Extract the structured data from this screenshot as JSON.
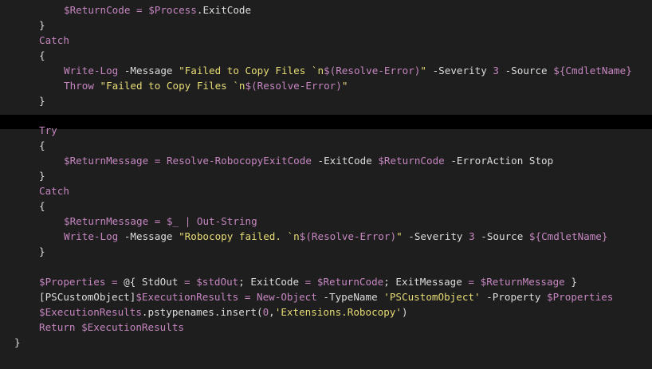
{
  "editor": {
    "theme_colors": {
      "background": "#1e1e1e",
      "separator": "#000000",
      "plain": "#dcdcdc",
      "variable": "#c586c0",
      "string": "#e6db74"
    },
    "top_lines": [
      [
        {
          "t": "var",
          "v": "$ReturnCode"
        },
        {
          "t": "plain",
          "v": " "
        },
        {
          "t": "op",
          "v": "="
        },
        {
          "t": "plain",
          "v": " "
        },
        {
          "t": "var",
          "v": "$Process"
        },
        {
          "t": "plain",
          "v": ".ExitCode"
        }
      ],
      [
        {
          "t": "plain",
          "v": "}"
        }
      ],
      [
        {
          "t": "kw",
          "v": "Catch"
        }
      ],
      [
        {
          "t": "plain",
          "v": "{"
        }
      ],
      [
        {
          "t": "cmd",
          "v": "Write-Log"
        },
        {
          "t": "plain",
          "v": " -Message "
        },
        {
          "t": "str",
          "v": "\"Failed to Copy Files `n"
        },
        {
          "t": "var",
          "v": "$(Resolve-Error)"
        },
        {
          "t": "str",
          "v": "\""
        },
        {
          "t": "plain",
          "v": " -Severity "
        },
        {
          "t": "num",
          "v": "3"
        },
        {
          "t": "plain",
          "v": " -Source "
        },
        {
          "t": "var",
          "v": "${CmdletName}"
        }
      ],
      [
        {
          "t": "kw",
          "v": "Throw"
        },
        {
          "t": "plain",
          "v": " "
        },
        {
          "t": "str",
          "v": "\"Failed to Copy Files `n"
        },
        {
          "t": "var",
          "v": "$(Resolve-Error)"
        },
        {
          "t": "str",
          "v": "\""
        }
      ],
      [
        {
          "t": "plain",
          "v": "}"
        }
      ]
    ],
    "bottom_lines": [
      [
        {
          "t": "kw",
          "v": "Try"
        }
      ],
      [
        {
          "t": "plain",
          "v": "{"
        }
      ],
      [
        {
          "t": "var",
          "v": "$ReturnMessage"
        },
        {
          "t": "plain",
          "v": " "
        },
        {
          "t": "op",
          "v": "="
        },
        {
          "t": "plain",
          "v": " "
        },
        {
          "t": "cmd",
          "v": "Resolve-RobocopyExitCode"
        },
        {
          "t": "plain",
          "v": " -ExitCode "
        },
        {
          "t": "var",
          "v": "$ReturnCode"
        },
        {
          "t": "plain",
          "v": " -ErrorAction Stop"
        }
      ],
      [
        {
          "t": "plain",
          "v": "}"
        }
      ],
      [
        {
          "t": "kw",
          "v": "Catch"
        }
      ],
      [
        {
          "t": "plain",
          "v": "{"
        }
      ],
      [
        {
          "t": "var",
          "v": "$ReturnMessage"
        },
        {
          "t": "plain",
          "v": " "
        },
        {
          "t": "op",
          "v": "="
        },
        {
          "t": "plain",
          "v": " "
        },
        {
          "t": "var",
          "v": "$_"
        },
        {
          "t": "plain",
          "v": " "
        },
        {
          "t": "op",
          "v": "|"
        },
        {
          "t": "plain",
          "v": " "
        },
        {
          "t": "cmd",
          "v": "Out-String"
        }
      ],
      [
        {
          "t": "cmd",
          "v": "Write-Log"
        },
        {
          "t": "plain",
          "v": " -Message "
        },
        {
          "t": "str",
          "v": "\"Robocopy failed. `n"
        },
        {
          "t": "var",
          "v": "$(Resolve-Error)"
        },
        {
          "t": "str",
          "v": "\""
        },
        {
          "t": "plain",
          "v": " -Severity "
        },
        {
          "t": "num",
          "v": "3"
        },
        {
          "t": "plain",
          "v": " -Source "
        },
        {
          "t": "var",
          "v": "${CmdletName}"
        }
      ],
      [
        {
          "t": "plain",
          "v": "}"
        }
      ],
      [
        {
          "t": "plain",
          "v": ""
        }
      ],
      [
        {
          "t": "var",
          "v": "$Properties"
        },
        {
          "t": "plain",
          "v": " "
        },
        {
          "t": "op",
          "v": "="
        },
        {
          "t": "plain",
          "v": " @{ StdOut "
        },
        {
          "t": "op",
          "v": "="
        },
        {
          "t": "plain",
          "v": " "
        },
        {
          "t": "var",
          "v": "$stdOut"
        },
        {
          "t": "plain",
          "v": "; ExitCode "
        },
        {
          "t": "op",
          "v": "="
        },
        {
          "t": "plain",
          "v": " "
        },
        {
          "t": "var",
          "v": "$ReturnCode"
        },
        {
          "t": "plain",
          "v": "; ExitMessage "
        },
        {
          "t": "op",
          "v": "="
        },
        {
          "t": "plain",
          "v": " "
        },
        {
          "t": "var",
          "v": "$ReturnMessage"
        },
        {
          "t": "plain",
          "v": " }"
        }
      ],
      [
        {
          "t": "type",
          "v": "[PSCustomObject]"
        },
        {
          "t": "var",
          "v": "$ExecutionResults"
        },
        {
          "t": "plain",
          "v": " "
        },
        {
          "t": "op",
          "v": "="
        },
        {
          "t": "plain",
          "v": " "
        },
        {
          "t": "cmd",
          "v": "New-Object"
        },
        {
          "t": "plain",
          "v": " -TypeName "
        },
        {
          "t": "str",
          "v": "'PSCustomObject'"
        },
        {
          "t": "plain",
          "v": " -Property "
        },
        {
          "t": "var",
          "v": "$Properties"
        }
      ],
      [
        {
          "t": "var",
          "v": "$ExecutionResults"
        },
        {
          "t": "plain",
          "v": ".pstypenames.insert("
        },
        {
          "t": "num",
          "v": "0"
        },
        {
          "t": "plain",
          "v": ","
        },
        {
          "t": "str",
          "v": "'Extensions.Robocopy'"
        },
        {
          "t": "plain",
          "v": ")"
        }
      ],
      [
        {
          "t": "kw",
          "v": "Return"
        },
        {
          "t": "plain",
          "v": " "
        },
        {
          "t": "var",
          "v": "$ExecutionResults"
        }
      ],
      [
        {
          "t": "plain",
          "v": "}"
        }
      ]
    ],
    "top_indents": [
      3,
      2,
      2,
      2,
      3,
      3,
      2
    ],
    "bottom_indents": [
      2,
      2,
      3,
      2,
      2,
      2,
      3,
      3,
      2,
      2,
      2,
      2,
      2,
      2,
      1
    ]
  }
}
